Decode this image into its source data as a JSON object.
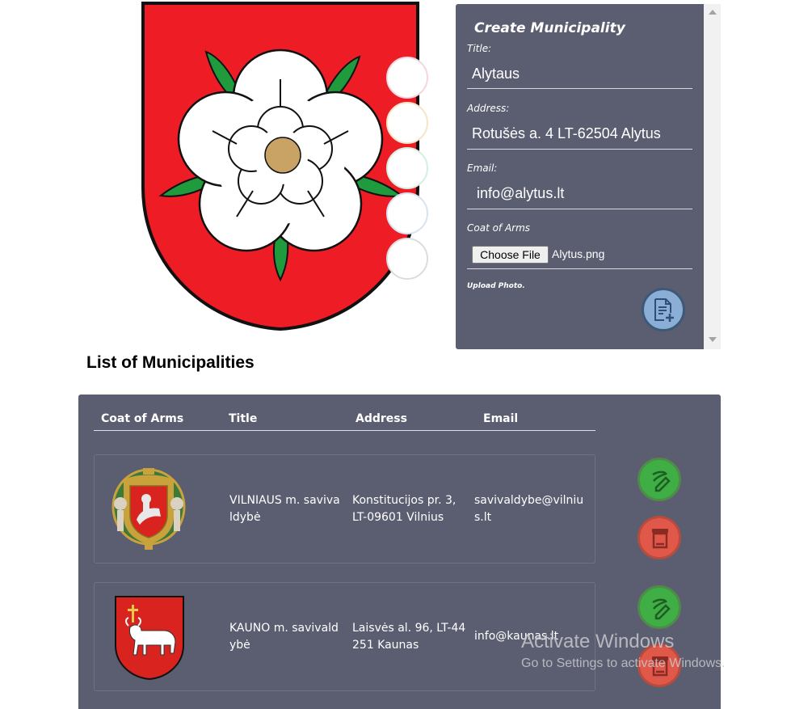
{
  "create_form": {
    "title": "Create Municipality",
    "title_label": "Title:",
    "title_value": "Alytaus",
    "address_label": "Address:",
    "address_value": "Rotušės a. 4 LT-62504 Alytus",
    "email_label": "Email:",
    "email_value": "info@alytus.lt",
    "coat_label": "Coat of Arms",
    "file_button_label": "Choose File",
    "file_name": "Alytus.png",
    "upload_hint": "Upload Photo."
  },
  "list": {
    "heading": "List of Municipalities",
    "columns": [
      "Coat of Arms",
      "Title",
      "Address",
      "Email"
    ],
    "rows": [
      {
        "title_line1": "VILNIAUS m. saviva",
        "title_line2": "ldybė",
        "address_line1": "Konstitucijos pr. 3,",
        "address_line2": "LT-09601 Vilnius",
        "email_line1": "savivaldybe@vilniu",
        "email_line2": "s.lt"
      },
      {
        "title_line1": "KAUNO m. savivald",
        "title_line2": "ybė",
        "address_line1": "Laisvės al. 96, LT-44",
        "address_line2": "251 Kaunas",
        "email_line1": "info@kaunas.lt"
      }
    ]
  },
  "watermark": {
    "line1": "Activate Windows",
    "line2": "Go to Settings to activate Windows."
  },
  "colors": {
    "panel_bg": "#5b5e70",
    "edit_green": "#3fae45",
    "delete_red": "#e0584a",
    "add_blue": "#8aaed6",
    "arms_red": "#ee1c25"
  }
}
